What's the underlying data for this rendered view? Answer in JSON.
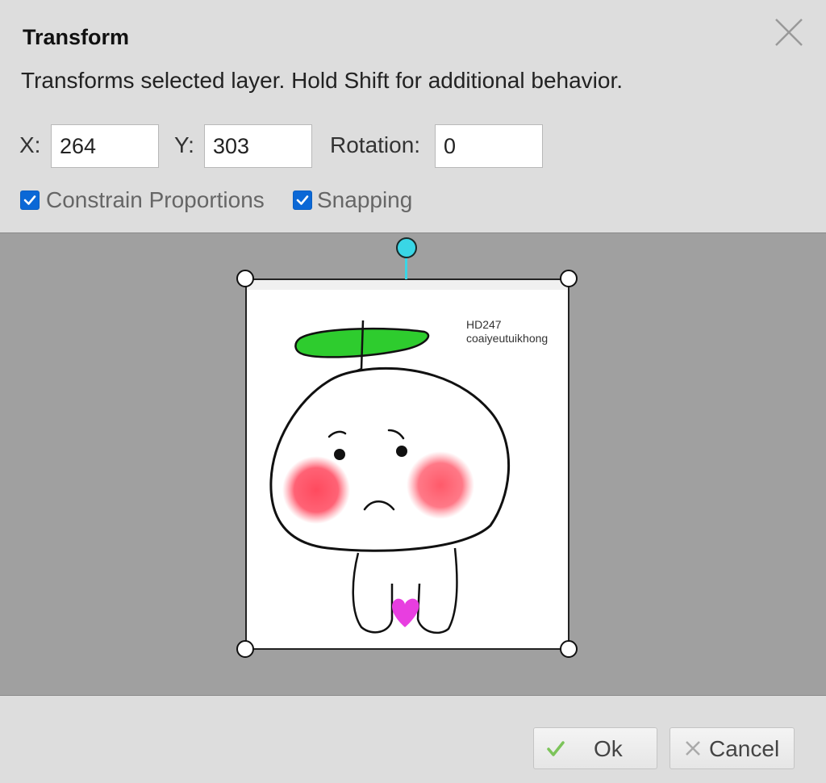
{
  "dialog": {
    "title": "Transform",
    "description": "Transforms selected layer. Hold Shift for additional behavior.",
    "close_icon": "close-icon"
  },
  "fields": {
    "x": {
      "label": "X:",
      "value": "264"
    },
    "y": {
      "label": "Y:",
      "value": "303"
    },
    "rotation": {
      "label": "Rotation:",
      "value": "0"
    }
  },
  "options": {
    "constrain": {
      "label": "Constrain Proportions",
      "checked": true
    },
    "snapping": {
      "label": "Snapping",
      "checked": true
    }
  },
  "layer": {
    "watermark_line1": "HD247",
    "watermark_line2": "coaiyeutuikhong"
  },
  "buttons": {
    "ok": {
      "label": "Ok",
      "icon": "checkmark-icon"
    },
    "cancel": {
      "label": "Cancel",
      "icon": "x-icon"
    }
  },
  "colors": {
    "checkbox_blue": "#0b68d6",
    "rotation_handle": "#39d6e6",
    "ok_check": "#7cc45a",
    "leaf_green": "#2ecc2e",
    "blush": "#ff5a6e",
    "heart": "#e83ee0"
  }
}
